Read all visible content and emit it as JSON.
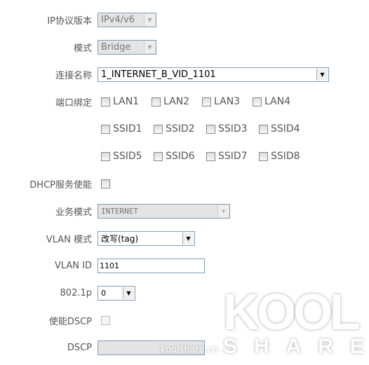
{
  "ip_version": {
    "label": "IP协议版本",
    "value": "IPv4/v6"
  },
  "mode": {
    "label": "模式",
    "value": "Bridge"
  },
  "connection_name": {
    "label": "连接名称",
    "value": "1_INTERNET_B_VID_1101"
  },
  "port_binding": {
    "label": "端口绑定",
    "options": [
      "LAN1",
      "LAN2",
      "LAN3",
      "LAN4",
      "SSID1",
      "SSID2",
      "SSID3",
      "SSID4",
      "SSID5",
      "SSID6",
      "SSID7",
      "SSID8"
    ]
  },
  "dhcp": {
    "label": "DHCP服务使能"
  },
  "service_mode": {
    "label": "业务模式",
    "value": "INTERNET"
  },
  "vlan_mode": {
    "label": "VLAN 模式",
    "value": "改写(tag)"
  },
  "vlan_id": {
    "label": "VLAN ID",
    "value": "1101"
  },
  "p8021": {
    "label": "802.1p",
    "value": "0"
  },
  "dscp_enable": {
    "label": "使能DSCP"
  },
  "dscp": {
    "label": "DSCP",
    "value": ""
  },
  "watermark": {
    "logo": "KOOL SHARE",
    "site": "koolshare.cn"
  }
}
